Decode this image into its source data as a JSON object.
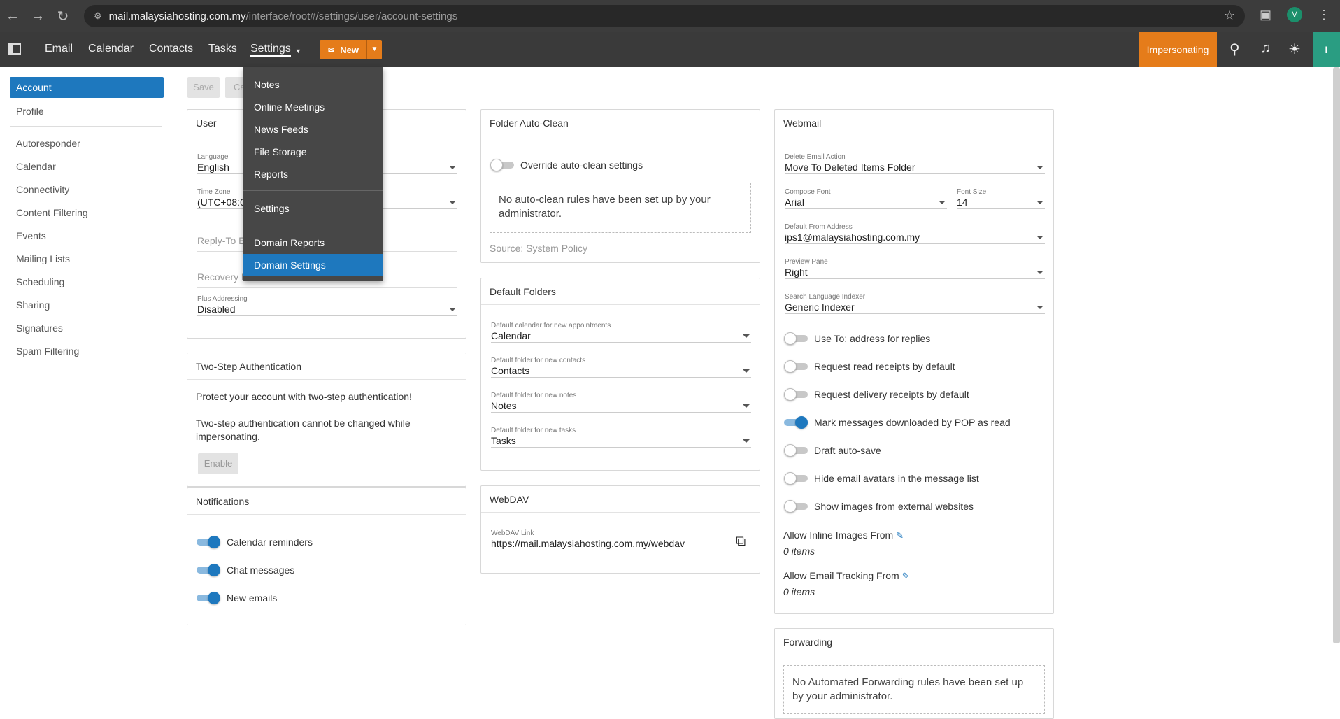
{
  "browser": {
    "url_host": "mail.malaysiahosting.com.my",
    "url_path": "/interface/root#/settings/user/account-settings",
    "profile_initial": "M"
  },
  "topnav": {
    "items": [
      "Email",
      "Calendar",
      "Contacts",
      "Tasks",
      "Settings"
    ],
    "new_label": "New",
    "impersonating_label": "Impersonating",
    "user_initial": "I"
  },
  "sidebar": {
    "top_items": [
      "Account",
      "Profile"
    ],
    "items": [
      "Autoresponder",
      "Calendar",
      "Connectivity",
      "Content Filtering",
      "Events",
      "Mailing Lists",
      "Scheduling",
      "Sharing",
      "Signatures",
      "Spam Filtering"
    ]
  },
  "toolbar": {
    "save_label": "Save",
    "cancel_label": "Ca"
  },
  "dropdown": {
    "group1": [
      "Notes",
      "Online Meetings",
      "News Feeds",
      "File Storage",
      "Reports"
    ],
    "group2": [
      "Settings"
    ],
    "group3": [
      "Domain Reports",
      "Domain Settings"
    ]
  },
  "user_panel": {
    "title": "User",
    "language_label": "Language",
    "language_value": "English",
    "timezone_label": "Time Zone",
    "timezone_value": "(UTC+08:0",
    "replyto_placeholder": "Reply-To E",
    "recovery_placeholder": "Recovery E",
    "plus_label": "Plus Addressing",
    "plus_value": "Disabled"
  },
  "twostep_panel": {
    "title": "Two-Step Authentication",
    "line1": "Protect your account with two-step authentication!",
    "line2": "Two-step authentication cannot be changed while impersonating.",
    "enable_label": "Enable"
  },
  "notifications_panel": {
    "title": "Notifications",
    "items": [
      "Calendar reminders",
      "Chat messages",
      "New emails"
    ]
  },
  "autoclean_panel": {
    "title": "Folder Auto-Clean",
    "toggle_label": "Override auto-clean settings",
    "empty_text": "No auto-clean rules have been set up by your administrator.",
    "source": "Source: System Policy"
  },
  "folders_panel": {
    "title": "Default Folders",
    "fields": [
      {
        "label": "Default calendar for new appointments",
        "value": "Calendar"
      },
      {
        "label": "Default folder for new contacts",
        "value": "Contacts"
      },
      {
        "label": "Default folder for new notes",
        "value": "Notes"
      },
      {
        "label": "Default folder for new tasks",
        "value": "Tasks"
      }
    ]
  },
  "webdav_panel": {
    "title": "WebDAV",
    "link_label": "WebDAV Link",
    "link_value": "https://mail.malaysiahosting.com.my/webdav"
  },
  "webmail_panel": {
    "title": "Webmail",
    "delete_label": "Delete Email Action",
    "delete_value": "Move To Deleted Items Folder",
    "font_label": "Compose Font",
    "font_value": "Arial",
    "size_label": "Font Size",
    "size_value": "14",
    "from_label": "Default From Address",
    "from_value": "ips1@malaysiahosting.com.my",
    "preview_label": "Preview Pane",
    "preview_value": "Right",
    "indexer_label": "Search Language Indexer",
    "indexer_value": "Generic Indexer",
    "toggles": [
      {
        "label": "Use To: address for replies",
        "on": false
      },
      {
        "label": "Request read receipts by default",
        "on": false
      },
      {
        "label": "Request delivery receipts by default",
        "on": false
      },
      {
        "label": "Mark messages downloaded by POP as read",
        "on": true
      },
      {
        "label": "Draft auto-save",
        "on": false
      },
      {
        "label": "Hide email avatars in the message list",
        "on": false
      },
      {
        "label": "Show images from external websites",
        "on": false
      }
    ],
    "inline_label": "Allow Inline Images From",
    "inline_count": "0 items",
    "tracking_label": "Allow Email Tracking From",
    "tracking_count": "0 items"
  },
  "forwarding_panel": {
    "title": "Forwarding",
    "empty_text": "No Automated Forwarding rules have been set up by your administrator."
  }
}
